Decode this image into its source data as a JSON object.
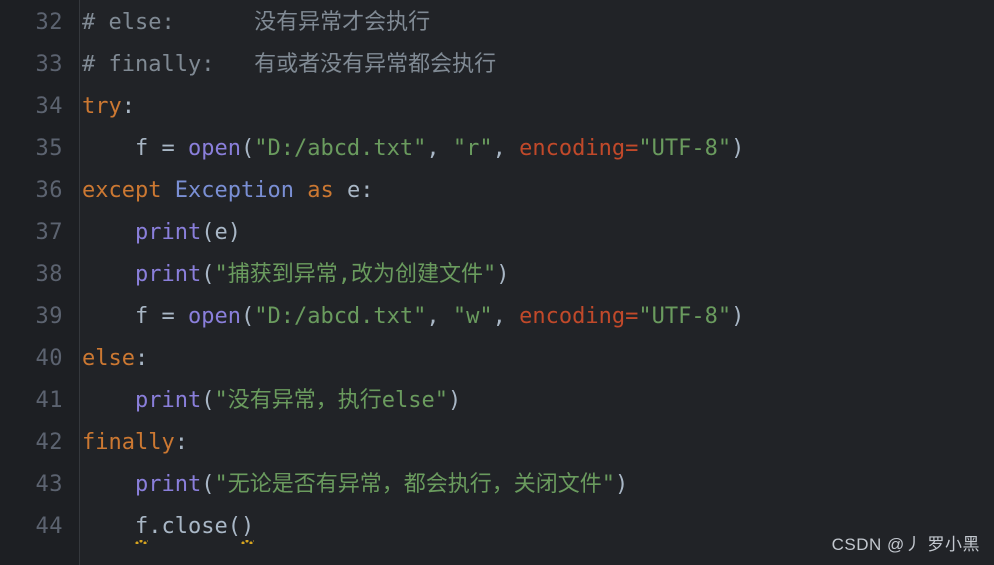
{
  "editor": {
    "language": "python",
    "theme": "darcula",
    "background": "#212327",
    "gutter_background": "#1d1f23",
    "gutter_divider": "#35383d",
    "default_text_color": "#a9b7c6",
    "colors": {
      "comment": "#808a94",
      "keyword": "#cc7832",
      "builtin_function": "#8a7fdb",
      "class_name": "#7a8fd4",
      "string": "#6a9b5e",
      "named_argument": "#c1492a",
      "error_squiggle": "#d6a420"
    },
    "first_line_number": 32,
    "last_line_number": 44
  },
  "gutter": {
    "line_numbers": [
      "32",
      "33",
      "34",
      "35",
      "36",
      "37",
      "38",
      "39",
      "40",
      "41",
      "42",
      "43",
      "44"
    ]
  },
  "lines": {
    "l32": {
      "number": "32",
      "text": "# else:      没有异常才会执行",
      "tokens": {
        "comment": "# else:      没有异常才会执行"
      }
    },
    "l33": {
      "number": "33",
      "text": "# finally:   有或者没有异常都会执行",
      "tokens": {
        "comment": "# finally:   有或者没有异常都会执行"
      }
    },
    "l34": {
      "number": "34",
      "text": "try:",
      "tokens": {
        "keyword": "try",
        "colon": ":"
      }
    },
    "l35": {
      "number": "35",
      "text": "    f = open(\"D:/abcd.txt\", \"r\", encoding=\"UTF-8\")",
      "tokens": {
        "indent": "    ",
        "var": "f",
        "assign": " = ",
        "builtin": "open",
        "paren_open": "(",
        "str_path": "\"D:/abcd.txt\"",
        "comma1": ", ",
        "str_mode": "\"r\"",
        "comma2": ", ",
        "named": "encoding",
        "equals": "=",
        "str_encoding": "\"UTF-8\"",
        "paren_close": ")"
      }
    },
    "l36": {
      "number": "36",
      "text": "except Exception as e:",
      "tokens": {
        "keyword_except": "except",
        "space1": " ",
        "class_name": "Exception",
        "space2": " ",
        "keyword_as": "as",
        "space3": " ",
        "var": "e",
        "colon": ":"
      }
    },
    "l37": {
      "number": "37",
      "text": "    print(e)",
      "tokens": {
        "indent": "    ",
        "builtin": "print",
        "paren_open": "(",
        "var": "e",
        "paren_close": ")"
      }
    },
    "l38": {
      "number": "38",
      "text": "    print(\"捕获到异常,改为创建文件\")",
      "tokens": {
        "indent": "    ",
        "builtin": "print",
        "paren_open": "(",
        "string": "\"捕获到异常,改为创建文件\"",
        "paren_close": ")"
      }
    },
    "l39": {
      "number": "39",
      "text": "    f = open(\"D:/abcd.txt\", \"w\", encoding=\"UTF-8\")",
      "tokens": {
        "indent": "    ",
        "var": "f",
        "assign": " = ",
        "builtin": "open",
        "paren_open": "(",
        "str_path": "\"D:/abcd.txt\"",
        "comma1": ", ",
        "str_mode": "\"w\"",
        "comma2": ", ",
        "named": "encoding",
        "equals": "=",
        "str_encoding": "\"UTF-8\"",
        "paren_close": ")"
      }
    },
    "l40": {
      "number": "40",
      "text": "else:",
      "tokens": {
        "keyword": "else",
        "colon": ":"
      }
    },
    "l41": {
      "number": "41",
      "text": "    print(\"没有异常，执行else\")",
      "tokens": {
        "indent": "    ",
        "builtin": "print",
        "paren_open": "(",
        "string": "\"没有异常，执行else\"",
        "paren_close": ")"
      }
    },
    "l42": {
      "number": "42",
      "text": "finally:",
      "tokens": {
        "keyword": "finally",
        "colon": ":"
      }
    },
    "l43": {
      "number": "43",
      "text": "    print(\"无论是否有异常，都会执行，关闭文件\")",
      "tokens": {
        "indent": "    ",
        "builtin": "print",
        "paren_open": "(",
        "string": "\"无论是否有异常，都会执行，关闭文件\"",
        "paren_close": ")"
      }
    },
    "l44": {
      "number": "44",
      "text": "    f.close()",
      "tokens": {
        "indent": "    ",
        "var": "f",
        "dot": ".",
        "method": "close",
        "paren_open": "(",
        "paren_close": ")"
      },
      "annotations": {
        "squiggle_on": [
          "f",
          ")"
        ],
        "squiggle_color": "#d6a420"
      }
    }
  },
  "watermark": {
    "text": "CSDN @丿 罗小黑"
  }
}
